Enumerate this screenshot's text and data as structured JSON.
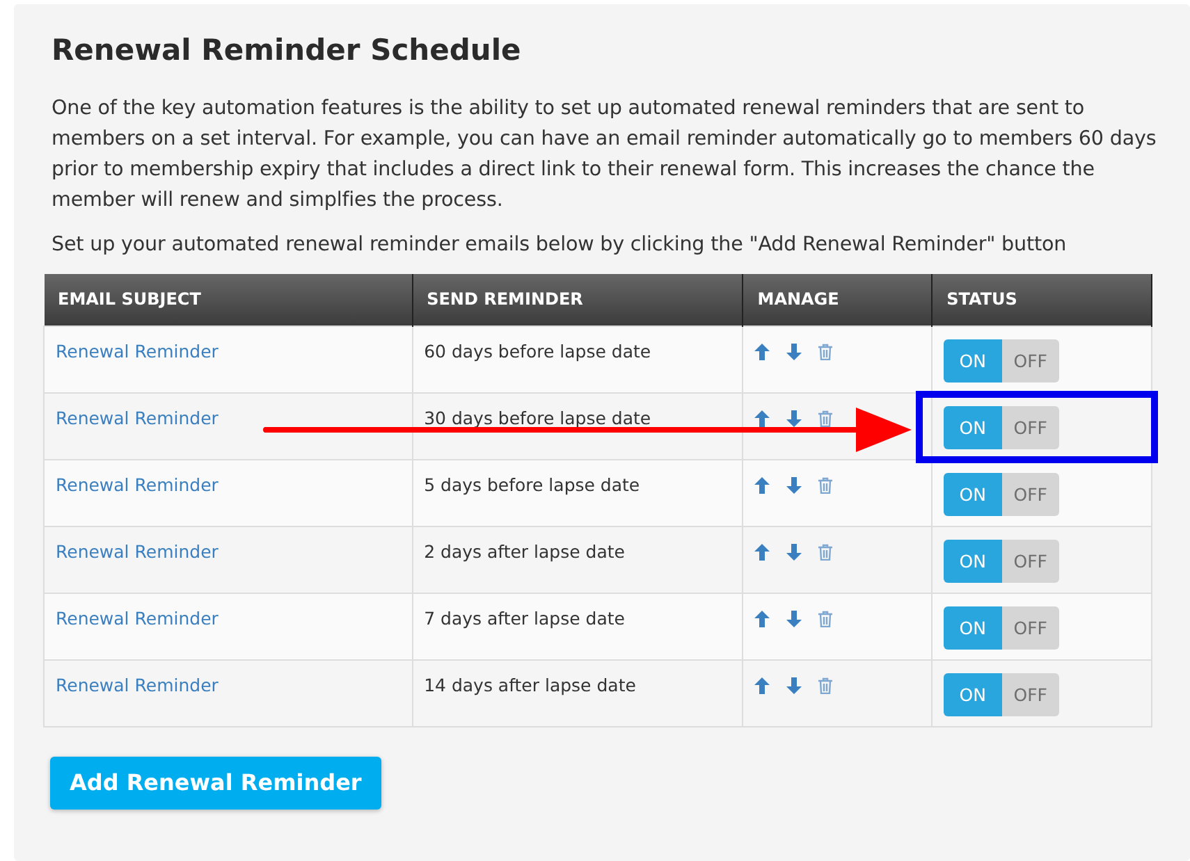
{
  "title": "Renewal Reminder Schedule",
  "paragraphs": [
    "One of the key automation features is the ability to set up automated renewal reminders that are sent to members on a set interval. For example, you can have an email reminder automatically go to members 60 days prior to membership expiry that includes a direct link to their renewal form. This increases the chance the member will renew and simplfies the process.",
    "Set up your automated renewal reminder emails below by clicking the \"Add Renewal Reminder\" button"
  ],
  "table": {
    "columns": [
      "EMAIL SUBJECT",
      "SEND REMINDER",
      "MANAGE",
      "STATUS"
    ],
    "rows": [
      {
        "subject": "Renewal Reminder",
        "send": "60 days before lapse date",
        "on_label": "ON",
        "off_label": "OFF",
        "on": true,
        "highlighted": false
      },
      {
        "subject": "Renewal Reminder",
        "send": "30 days before lapse date",
        "on_label": "ON",
        "off_label": "OFF",
        "on": true,
        "highlighted": true
      },
      {
        "subject": "Renewal Reminder",
        "send": "5 days before lapse date",
        "on_label": "ON",
        "off_label": "OFF",
        "on": true,
        "highlighted": false
      },
      {
        "subject": "Renewal Reminder",
        "send": "2 days after lapse date",
        "on_label": "ON",
        "off_label": "OFF",
        "on": true,
        "highlighted": false
      },
      {
        "subject": "Renewal Reminder",
        "send": "7 days after lapse date",
        "on_label": "ON",
        "off_label": "OFF",
        "on": true,
        "highlighted": false
      },
      {
        "subject": "Renewal Reminder",
        "send": "14 days after lapse date",
        "on_label": "ON",
        "off_label": "OFF",
        "on": true,
        "highlighted": false
      }
    ]
  },
  "button": "Add Renewal Reminder"
}
